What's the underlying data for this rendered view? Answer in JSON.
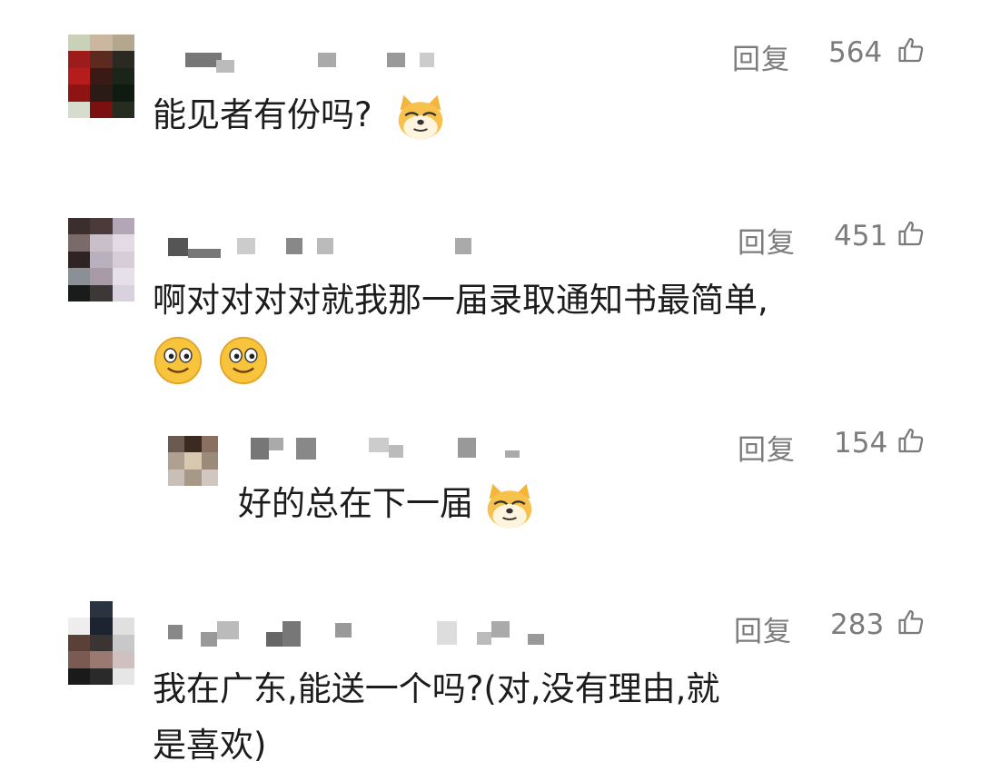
{
  "comments": [
    {
      "text": "能见者有份吗?",
      "reply_label": "回复",
      "like_count": "564",
      "icons": [
        "doge-emoji"
      ]
    },
    {
      "text_line1": "啊对对对对就我那一届录取通知书最简单,",
      "reply_label": "回复",
      "like_count": "451",
      "icons": [
        "smile-emoji",
        "smile-emoji"
      ]
    },
    {
      "text": "好的总在下一届",
      "reply_label": "回复",
      "like_count": "154",
      "icons": [
        "doge-emoji"
      ]
    },
    {
      "text_line1": "我在广东,能送一个吗?(对,没有理由,就",
      "text_line2": "是喜欢)",
      "reply_label": "回复",
      "like_count": "283"
    }
  ],
  "icons": {
    "like": "thumbs-up-icon"
  }
}
